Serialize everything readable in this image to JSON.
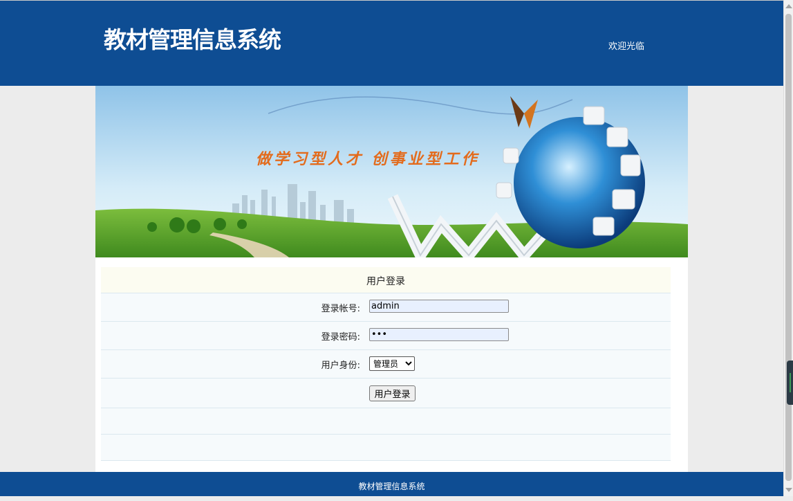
{
  "header": {
    "site_title": "教材管理信息系统",
    "welcome_text": "欢迎光临"
  },
  "banner": {
    "slogan": "做学习型人才  创事业型工作"
  },
  "login": {
    "form_title": "用户登录",
    "account_label": "登录帐号:",
    "account_value": "admin",
    "password_label": "登录密码:",
    "password_value": "•••",
    "role_label": "用户身份:",
    "role_selected": "管理员",
    "submit_label": "用户登录"
  },
  "footer": {
    "text": "教材管理信息系统"
  },
  "colors": {
    "header_bg": "#0e4d93",
    "title_row_bg": "#fcfcf1",
    "row_bg": "#f6fafc"
  }
}
